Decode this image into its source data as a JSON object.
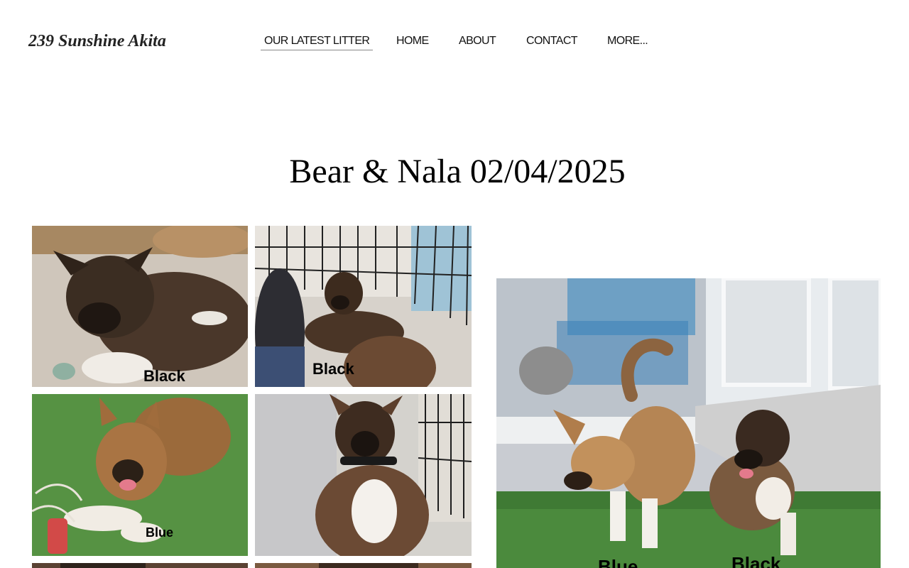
{
  "header": {
    "site_title": "239 Sunshine Akita",
    "nav": [
      {
        "label": "OUR LATEST LITTER",
        "active": true
      },
      {
        "label": "HOME",
        "active": false
      },
      {
        "label": "ABOUT",
        "active": false
      },
      {
        "label": "CONTACT",
        "active": false
      },
      {
        "label": "MORE...",
        "active": false
      }
    ]
  },
  "main": {
    "title": "Bear & Nala 02/04/2025",
    "gallery": [
      {
        "caption": "Black"
      },
      {
        "caption": "Black"
      },
      {
        "caption": "Blue"
      },
      {
        "caption": ""
      }
    ],
    "feature_photo": {
      "captions": [
        "Blue",
        "Black"
      ]
    }
  }
}
